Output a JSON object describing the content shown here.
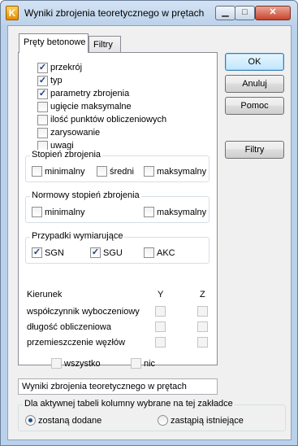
{
  "window": {
    "title": "Wyniki zbrojenia teoretycznego w prętach",
    "min_label": "▁",
    "max_label": "□",
    "close_label": "✕"
  },
  "tabs": [
    {
      "label": "Pręty betonowe",
      "active": true
    },
    {
      "label": "Filtry",
      "active": false
    }
  ],
  "options": [
    {
      "label": "przekrój",
      "checked": true
    },
    {
      "label": "typ",
      "checked": true
    },
    {
      "label": "parametry zbrojenia",
      "checked": true
    },
    {
      "label": "ugięcie maksymalne",
      "checked": false
    },
    {
      "label": "ilość punktów obliczeniowych",
      "checked": false
    },
    {
      "label": "zarysowanie",
      "checked": false
    },
    {
      "label": "uwagi",
      "checked": false
    }
  ],
  "stopien": {
    "title": "Stopień zbrojenia",
    "items": [
      {
        "label": "minimalny",
        "checked": false
      },
      {
        "label": "średni",
        "checked": false
      },
      {
        "label": "maksymalny",
        "checked": false
      }
    ]
  },
  "normowy": {
    "title": "Normowy stopień zbrojenia",
    "items": [
      {
        "label": "minimalny",
        "checked": false
      },
      {
        "label": "maksymalny",
        "checked": false
      }
    ]
  },
  "przypadki": {
    "title": "Przypadki wymiarujące",
    "items": [
      {
        "label": "SGN",
        "checked": true
      },
      {
        "label": "SGU",
        "checked": true
      },
      {
        "label": "AKC",
        "checked": false
      }
    ]
  },
  "kierunek": {
    "label": "Kierunek",
    "col_y": "Y",
    "col_z": "Z",
    "rows": [
      {
        "label": "współczynnik wyboczeniowy"
      },
      {
        "label": "długość obliczeniowa"
      },
      {
        "label": "przemieszczenie węzłów"
      }
    ],
    "all_label": "wszystko",
    "none_label": "nic"
  },
  "buttons": {
    "ok": "OK",
    "cancel": "Anuluj",
    "help": "Pomoc",
    "filters": "Filtry"
  },
  "table_name": "Wyniki zbrojenia teoretycznego w prętach",
  "bottom": {
    "title": "Dla aktywnej tabeli kolumny wybrane na tej zakładce",
    "option1": "zostaną dodane",
    "option2": "zastąpią istniejące",
    "selected": "option1"
  }
}
